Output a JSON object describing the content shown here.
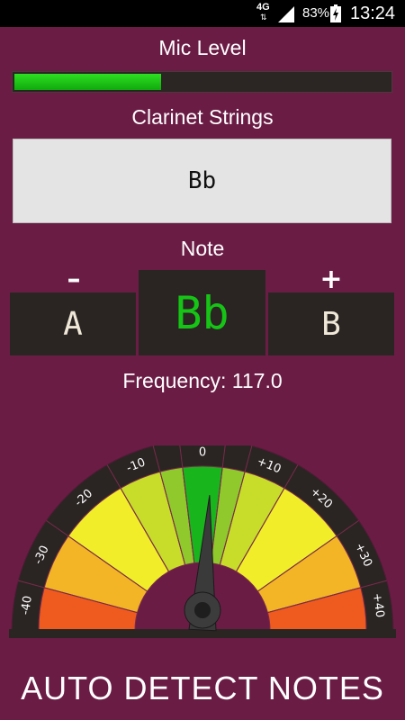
{
  "status_bar": {
    "network": "4G",
    "battery_percent": "83%",
    "battery_level": 0.83,
    "time": "13:24"
  },
  "mic": {
    "title": "Mic Level",
    "level": 0.39
  },
  "string_selector": {
    "title": "Clarinet Strings",
    "value": "Bb"
  },
  "note": {
    "title": "Note",
    "minus_label": "–",
    "plus_label": "+",
    "prev": "A",
    "current": "Bb",
    "next": "B"
  },
  "frequency": {
    "text": "Frequency: 117.0"
  },
  "gauge": {
    "ticks": [
      "-40",
      "-30",
      "-20",
      "-10",
      "0",
      "+10",
      "+20",
      "+30",
      "+40"
    ],
    "needle_cents": 3,
    "colors": {
      "center": "#19b51d",
      "lightgreen": "#8fc92b",
      "yellowgreen": "#c8dc2a",
      "yellow": "#f1ee29",
      "orange": "#f3b526",
      "red": "#ef5b1f"
    }
  },
  "action": {
    "auto_detect_label": "AUTO DETECT NOTES"
  }
}
